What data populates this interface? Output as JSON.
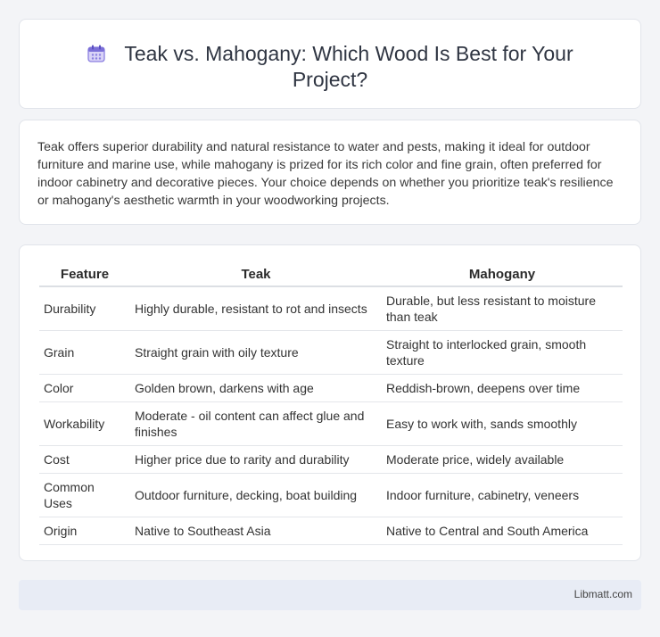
{
  "header": {
    "title": "Teak vs. Mahogany: Which Wood Is Best for Your Project?",
    "icon": "calendar-icon",
    "icon_color": "#7b6fd8"
  },
  "intro": {
    "text": "Teak offers superior durability and natural resistance to water and pests, making it ideal for outdoor furniture and marine use, while mahogany is prized for its rich color and fine grain, often preferred for indoor cabinetry and decorative pieces. Your choice depends on whether you prioritize teak's resilience or mahogany's aesthetic warmth in your woodworking projects."
  },
  "table": {
    "headers": [
      "Feature",
      "Teak",
      "Mahogany"
    ],
    "rows": [
      {
        "feature": "Durability",
        "teak": "Highly durable, resistant to rot and insects",
        "mahogany": "Durable, but less resistant to moisture than teak"
      },
      {
        "feature": "Grain",
        "teak": "Straight grain with oily texture",
        "mahogany": "Straight to interlocked grain, smooth texture"
      },
      {
        "feature": "Color",
        "teak": "Golden brown, darkens with age",
        "mahogany": "Reddish-brown, deepens over time"
      },
      {
        "feature": "Workability",
        "teak": "Moderate - oil content can affect glue and finishes",
        "mahogany": "Easy to work with, sands smoothly"
      },
      {
        "feature": "Cost",
        "teak": "Higher price due to rarity and durability",
        "mahogany": "Moderate price, widely available"
      },
      {
        "feature": "Common Uses",
        "teak": "Outdoor furniture, decking, boat building",
        "mahogany": "Indoor furniture, cabinetry, veneers"
      },
      {
        "feature": "Origin",
        "teak": "Native to Southeast Asia",
        "mahogany": "Native to Central and South America"
      }
    ]
  },
  "footer": {
    "brand": "Libmatt.com"
  }
}
